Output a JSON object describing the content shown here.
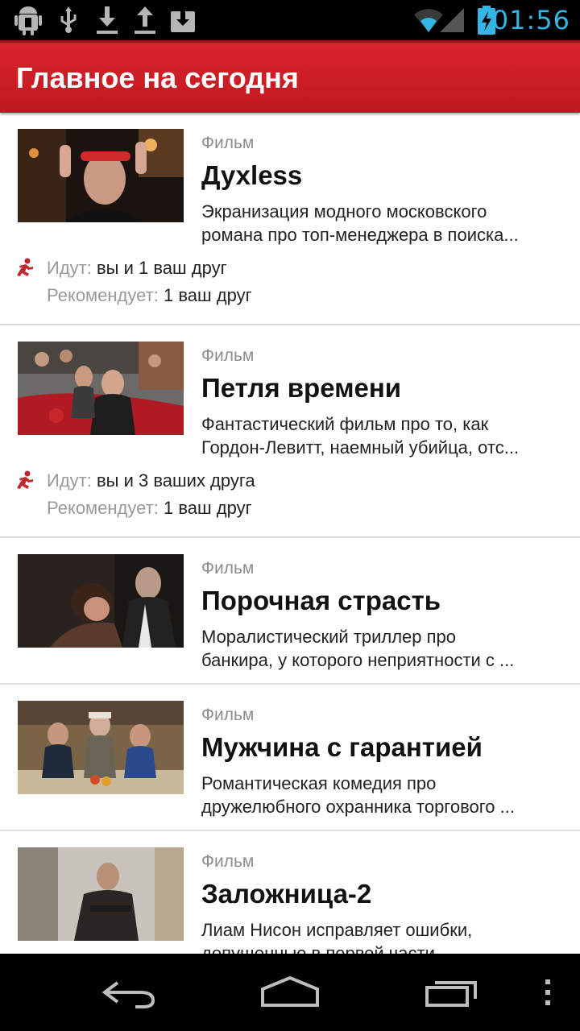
{
  "status_bar": {
    "time": "01:56",
    "icons": [
      "android-debug-icon",
      "usb-icon",
      "download-icon",
      "upload-icon",
      "inbox-download-icon",
      "wifi-icon",
      "signal-icon",
      "battery-charging-icon"
    ]
  },
  "header": {
    "title": "Главное на сегодня"
  },
  "items": [
    {
      "category": "Фильм",
      "title": "Духless",
      "desc_line1": "Экранизация модного московского",
      "desc_line2": "романа про топ-менеджера в поиска...",
      "going_key": "Идут:",
      "going_value": "вы и 1 ваш друг",
      "recommends_key": "Рекомендует:",
      "recommends_value": "1 ваш друг"
    },
    {
      "category": "Фильм",
      "title": "Петля времени",
      "desc_line1": "Фантастический фильм про то, как",
      "desc_line2": "Гордон-Левитт, наемный убийца, отс...",
      "going_key": "Идут:",
      "going_value": "вы и 3 ваших друга",
      "recommends_key": "Рекомендует:",
      "recommends_value": "1 ваш друг"
    },
    {
      "category": "Фильм",
      "title": "Порочная страсть",
      "desc_line1": "Моралистический триллер про",
      "desc_line2": "банкира, у которого неприятности с ..."
    },
    {
      "category": "Фильм",
      "title": "Мужчина с гарантией",
      "desc_line1": "Романтическая комедия про",
      "desc_line2": "дружелюбного охранника торгового ..."
    },
    {
      "category": "Фильм",
      "title": "Заложница-2",
      "desc_line1": "Лиам Нисон исправляет ошибки,",
      "desc_line2": "допущенные в первой части"
    }
  ],
  "nav_bar": {
    "icons": [
      "back-icon",
      "home-icon",
      "recent-apps-icon",
      "overflow-menu-icon"
    ]
  },
  "colors": {
    "accent": "#cc1f26",
    "clock": "#33b5e5",
    "social_icon": "#c0282e"
  }
}
